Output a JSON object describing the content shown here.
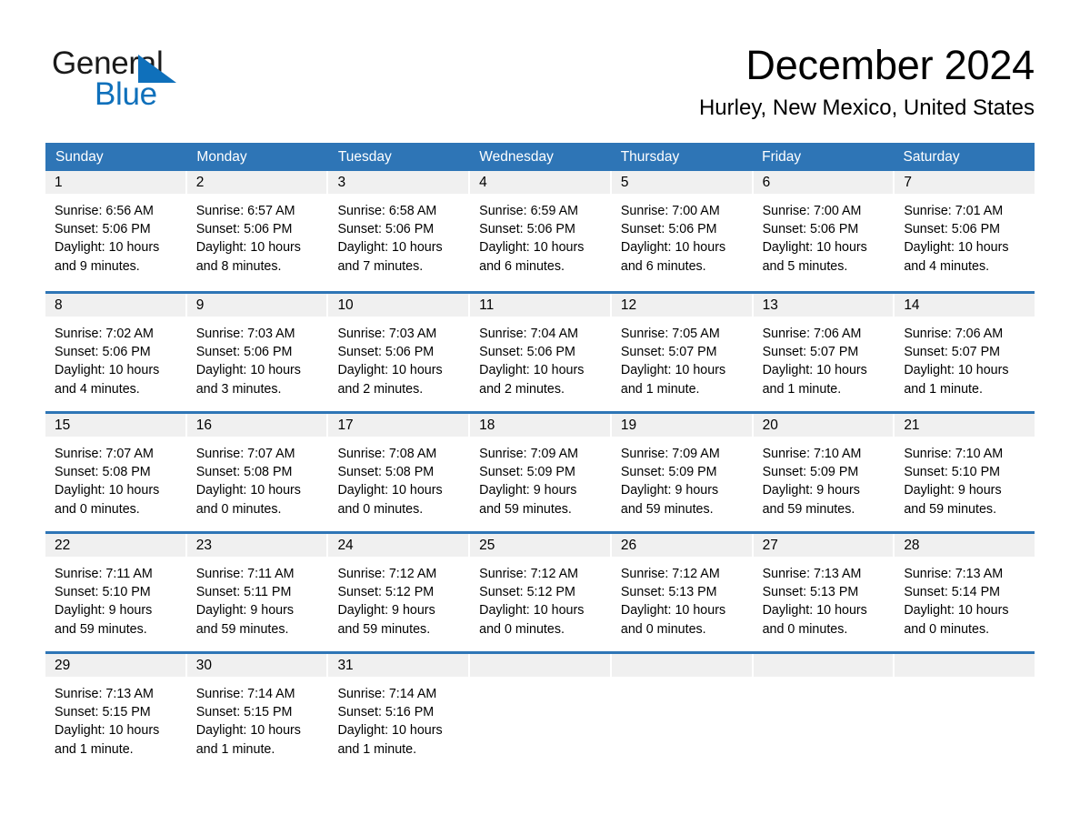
{
  "logo": {
    "word_one": "General",
    "word_two": "Blue",
    "triangle_color": "#0f70bb"
  },
  "header": {
    "month_title": "December 2024",
    "location": "Hurley, New Mexico, United States"
  },
  "theme": {
    "header_blue": "#2e75b6",
    "row_divider_blue": "#2e75b6",
    "daynum_band_gray": "#f0f0f0",
    "text_black": "#000000",
    "logo_blue": "#0f70bb"
  },
  "calendar": {
    "weekdays": [
      "Sunday",
      "Monday",
      "Tuesday",
      "Wednesday",
      "Thursday",
      "Friday",
      "Saturday"
    ],
    "weeks": [
      [
        {
          "day": "1",
          "sunrise": "Sunrise: 6:56 AM",
          "sunset": "Sunset: 5:06 PM",
          "daylight_1": "Daylight: 10 hours",
          "daylight_2": "and 9 minutes."
        },
        {
          "day": "2",
          "sunrise": "Sunrise: 6:57 AM",
          "sunset": "Sunset: 5:06 PM",
          "daylight_1": "Daylight: 10 hours",
          "daylight_2": "and 8 minutes."
        },
        {
          "day": "3",
          "sunrise": "Sunrise: 6:58 AM",
          "sunset": "Sunset: 5:06 PM",
          "daylight_1": "Daylight: 10 hours",
          "daylight_2": "and 7 minutes."
        },
        {
          "day": "4",
          "sunrise": "Sunrise: 6:59 AM",
          "sunset": "Sunset: 5:06 PM",
          "daylight_1": "Daylight: 10 hours",
          "daylight_2": "and 6 minutes."
        },
        {
          "day": "5",
          "sunrise": "Sunrise: 7:00 AM",
          "sunset": "Sunset: 5:06 PM",
          "daylight_1": "Daylight: 10 hours",
          "daylight_2": "and 6 minutes."
        },
        {
          "day": "6",
          "sunrise": "Sunrise: 7:00 AM",
          "sunset": "Sunset: 5:06 PM",
          "daylight_1": "Daylight: 10 hours",
          "daylight_2": "and 5 minutes."
        },
        {
          "day": "7",
          "sunrise": "Sunrise: 7:01 AM",
          "sunset": "Sunset: 5:06 PM",
          "daylight_1": "Daylight: 10 hours",
          "daylight_2": "and 4 minutes."
        }
      ],
      [
        {
          "day": "8",
          "sunrise": "Sunrise: 7:02 AM",
          "sunset": "Sunset: 5:06 PM",
          "daylight_1": "Daylight: 10 hours",
          "daylight_2": "and 4 minutes."
        },
        {
          "day": "9",
          "sunrise": "Sunrise: 7:03 AM",
          "sunset": "Sunset: 5:06 PM",
          "daylight_1": "Daylight: 10 hours",
          "daylight_2": "and 3 minutes."
        },
        {
          "day": "10",
          "sunrise": "Sunrise: 7:03 AM",
          "sunset": "Sunset: 5:06 PM",
          "daylight_1": "Daylight: 10 hours",
          "daylight_2": "and 2 minutes."
        },
        {
          "day": "11",
          "sunrise": "Sunrise: 7:04 AM",
          "sunset": "Sunset: 5:06 PM",
          "daylight_1": "Daylight: 10 hours",
          "daylight_2": "and 2 minutes."
        },
        {
          "day": "12",
          "sunrise": "Sunrise: 7:05 AM",
          "sunset": "Sunset: 5:07 PM",
          "daylight_1": "Daylight: 10 hours",
          "daylight_2": "and 1 minute."
        },
        {
          "day": "13",
          "sunrise": "Sunrise: 7:06 AM",
          "sunset": "Sunset: 5:07 PM",
          "daylight_1": "Daylight: 10 hours",
          "daylight_2": "and 1 minute."
        },
        {
          "day": "14",
          "sunrise": "Sunrise: 7:06 AM",
          "sunset": "Sunset: 5:07 PM",
          "daylight_1": "Daylight: 10 hours",
          "daylight_2": "and 1 minute."
        }
      ],
      [
        {
          "day": "15",
          "sunrise": "Sunrise: 7:07 AM",
          "sunset": "Sunset: 5:08 PM",
          "daylight_1": "Daylight: 10 hours",
          "daylight_2": "and 0 minutes."
        },
        {
          "day": "16",
          "sunrise": "Sunrise: 7:07 AM",
          "sunset": "Sunset: 5:08 PM",
          "daylight_1": "Daylight: 10 hours",
          "daylight_2": "and 0 minutes."
        },
        {
          "day": "17",
          "sunrise": "Sunrise: 7:08 AM",
          "sunset": "Sunset: 5:08 PM",
          "daylight_1": "Daylight: 10 hours",
          "daylight_2": "and 0 minutes."
        },
        {
          "day": "18",
          "sunrise": "Sunrise: 7:09 AM",
          "sunset": "Sunset: 5:09 PM",
          "daylight_1": "Daylight: 9 hours",
          "daylight_2": "and 59 minutes."
        },
        {
          "day": "19",
          "sunrise": "Sunrise: 7:09 AM",
          "sunset": "Sunset: 5:09 PM",
          "daylight_1": "Daylight: 9 hours",
          "daylight_2": "and 59 minutes."
        },
        {
          "day": "20",
          "sunrise": "Sunrise: 7:10 AM",
          "sunset": "Sunset: 5:09 PM",
          "daylight_1": "Daylight: 9 hours",
          "daylight_2": "and 59 minutes."
        },
        {
          "day": "21",
          "sunrise": "Sunrise: 7:10 AM",
          "sunset": "Sunset: 5:10 PM",
          "daylight_1": "Daylight: 9 hours",
          "daylight_2": "and 59 minutes."
        }
      ],
      [
        {
          "day": "22",
          "sunrise": "Sunrise: 7:11 AM",
          "sunset": "Sunset: 5:10 PM",
          "daylight_1": "Daylight: 9 hours",
          "daylight_2": "and 59 minutes."
        },
        {
          "day": "23",
          "sunrise": "Sunrise: 7:11 AM",
          "sunset": "Sunset: 5:11 PM",
          "daylight_1": "Daylight: 9 hours",
          "daylight_2": "and 59 minutes."
        },
        {
          "day": "24",
          "sunrise": "Sunrise: 7:12 AM",
          "sunset": "Sunset: 5:12 PM",
          "daylight_1": "Daylight: 9 hours",
          "daylight_2": "and 59 minutes."
        },
        {
          "day": "25",
          "sunrise": "Sunrise: 7:12 AM",
          "sunset": "Sunset: 5:12 PM",
          "daylight_1": "Daylight: 10 hours",
          "daylight_2": "and 0 minutes."
        },
        {
          "day": "26",
          "sunrise": "Sunrise: 7:12 AM",
          "sunset": "Sunset: 5:13 PM",
          "daylight_1": "Daylight: 10 hours",
          "daylight_2": "and 0 minutes."
        },
        {
          "day": "27",
          "sunrise": "Sunrise: 7:13 AM",
          "sunset": "Sunset: 5:13 PM",
          "daylight_1": "Daylight: 10 hours",
          "daylight_2": "and 0 minutes."
        },
        {
          "day": "28",
          "sunrise": "Sunrise: 7:13 AM",
          "sunset": "Sunset: 5:14 PM",
          "daylight_1": "Daylight: 10 hours",
          "daylight_2": "and 0 minutes."
        }
      ],
      [
        {
          "day": "29",
          "sunrise": "Sunrise: 7:13 AM",
          "sunset": "Sunset: 5:15 PM",
          "daylight_1": "Daylight: 10 hours",
          "daylight_2": "and 1 minute."
        },
        {
          "day": "30",
          "sunrise": "Sunrise: 7:14 AM",
          "sunset": "Sunset: 5:15 PM",
          "daylight_1": "Daylight: 10 hours",
          "daylight_2": "and 1 minute."
        },
        {
          "day": "31",
          "sunrise": "Sunrise: 7:14 AM",
          "sunset": "Sunset: 5:16 PM",
          "daylight_1": "Daylight: 10 hours",
          "daylight_2": "and 1 minute."
        },
        {
          "day": "",
          "sunrise": "",
          "sunset": "",
          "daylight_1": "",
          "daylight_2": ""
        },
        {
          "day": "",
          "sunrise": "",
          "sunset": "",
          "daylight_1": "",
          "daylight_2": ""
        },
        {
          "day": "",
          "sunrise": "",
          "sunset": "",
          "daylight_1": "",
          "daylight_2": ""
        },
        {
          "day": "",
          "sunrise": "",
          "sunset": "",
          "daylight_1": "",
          "daylight_2": ""
        }
      ]
    ]
  }
}
